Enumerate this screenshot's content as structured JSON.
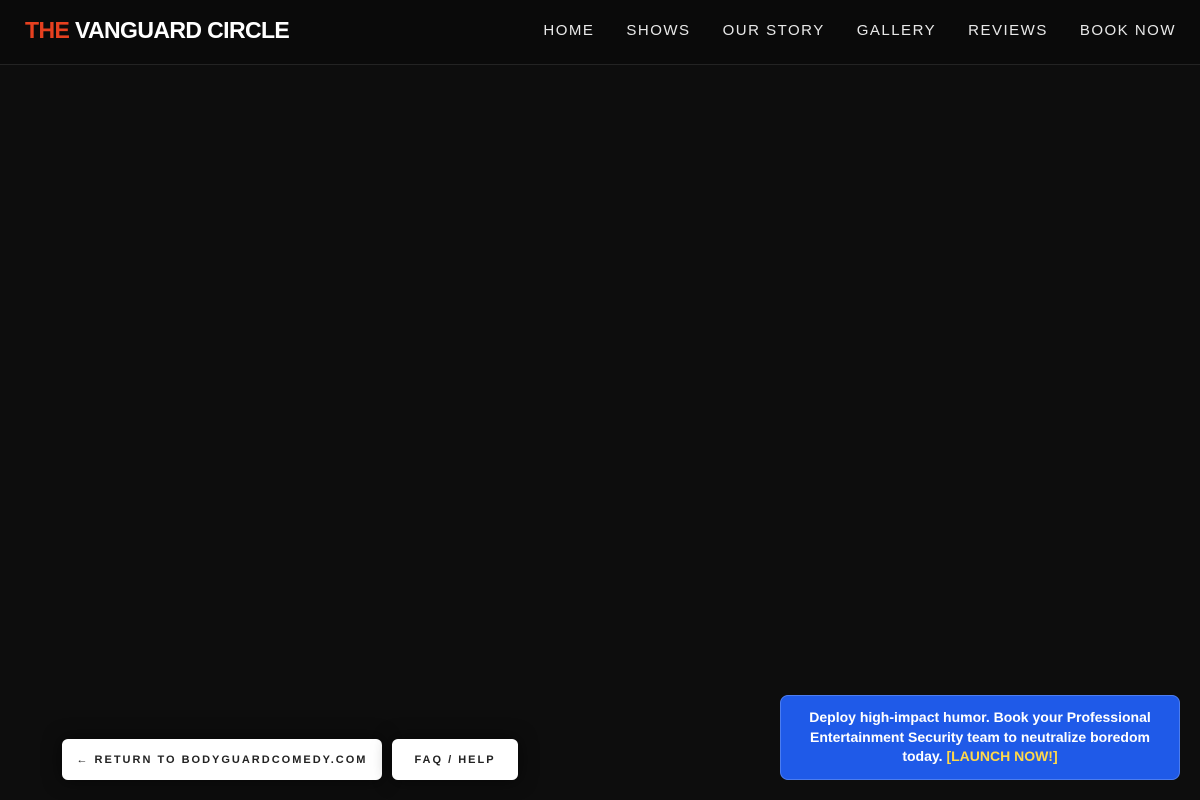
{
  "header": {
    "logo": {
      "accent": "THE",
      "rest": " VANGUARD CIRCLE"
    },
    "nav": [
      "HOME",
      "SHOWS",
      "OUR STORY",
      "GALLERY",
      "REVIEWS",
      "BOOK NOW"
    ]
  },
  "footer_buttons": {
    "return_label": "← RETURN TO BODYGUARDCOMEDY.COM",
    "faq_label": "FAQ / HELP"
  },
  "promo": {
    "text": "Deploy high-impact humor. Book your Professional Entertainment Security team to neutralize boredom today.",
    "cta": "[LAUNCH NOW!]"
  },
  "colors": {
    "accent": "#e6401f",
    "background": "#0d0d0d",
    "promo_blue": "#1f5ae8",
    "cta_yellow": "#ffd84a"
  }
}
